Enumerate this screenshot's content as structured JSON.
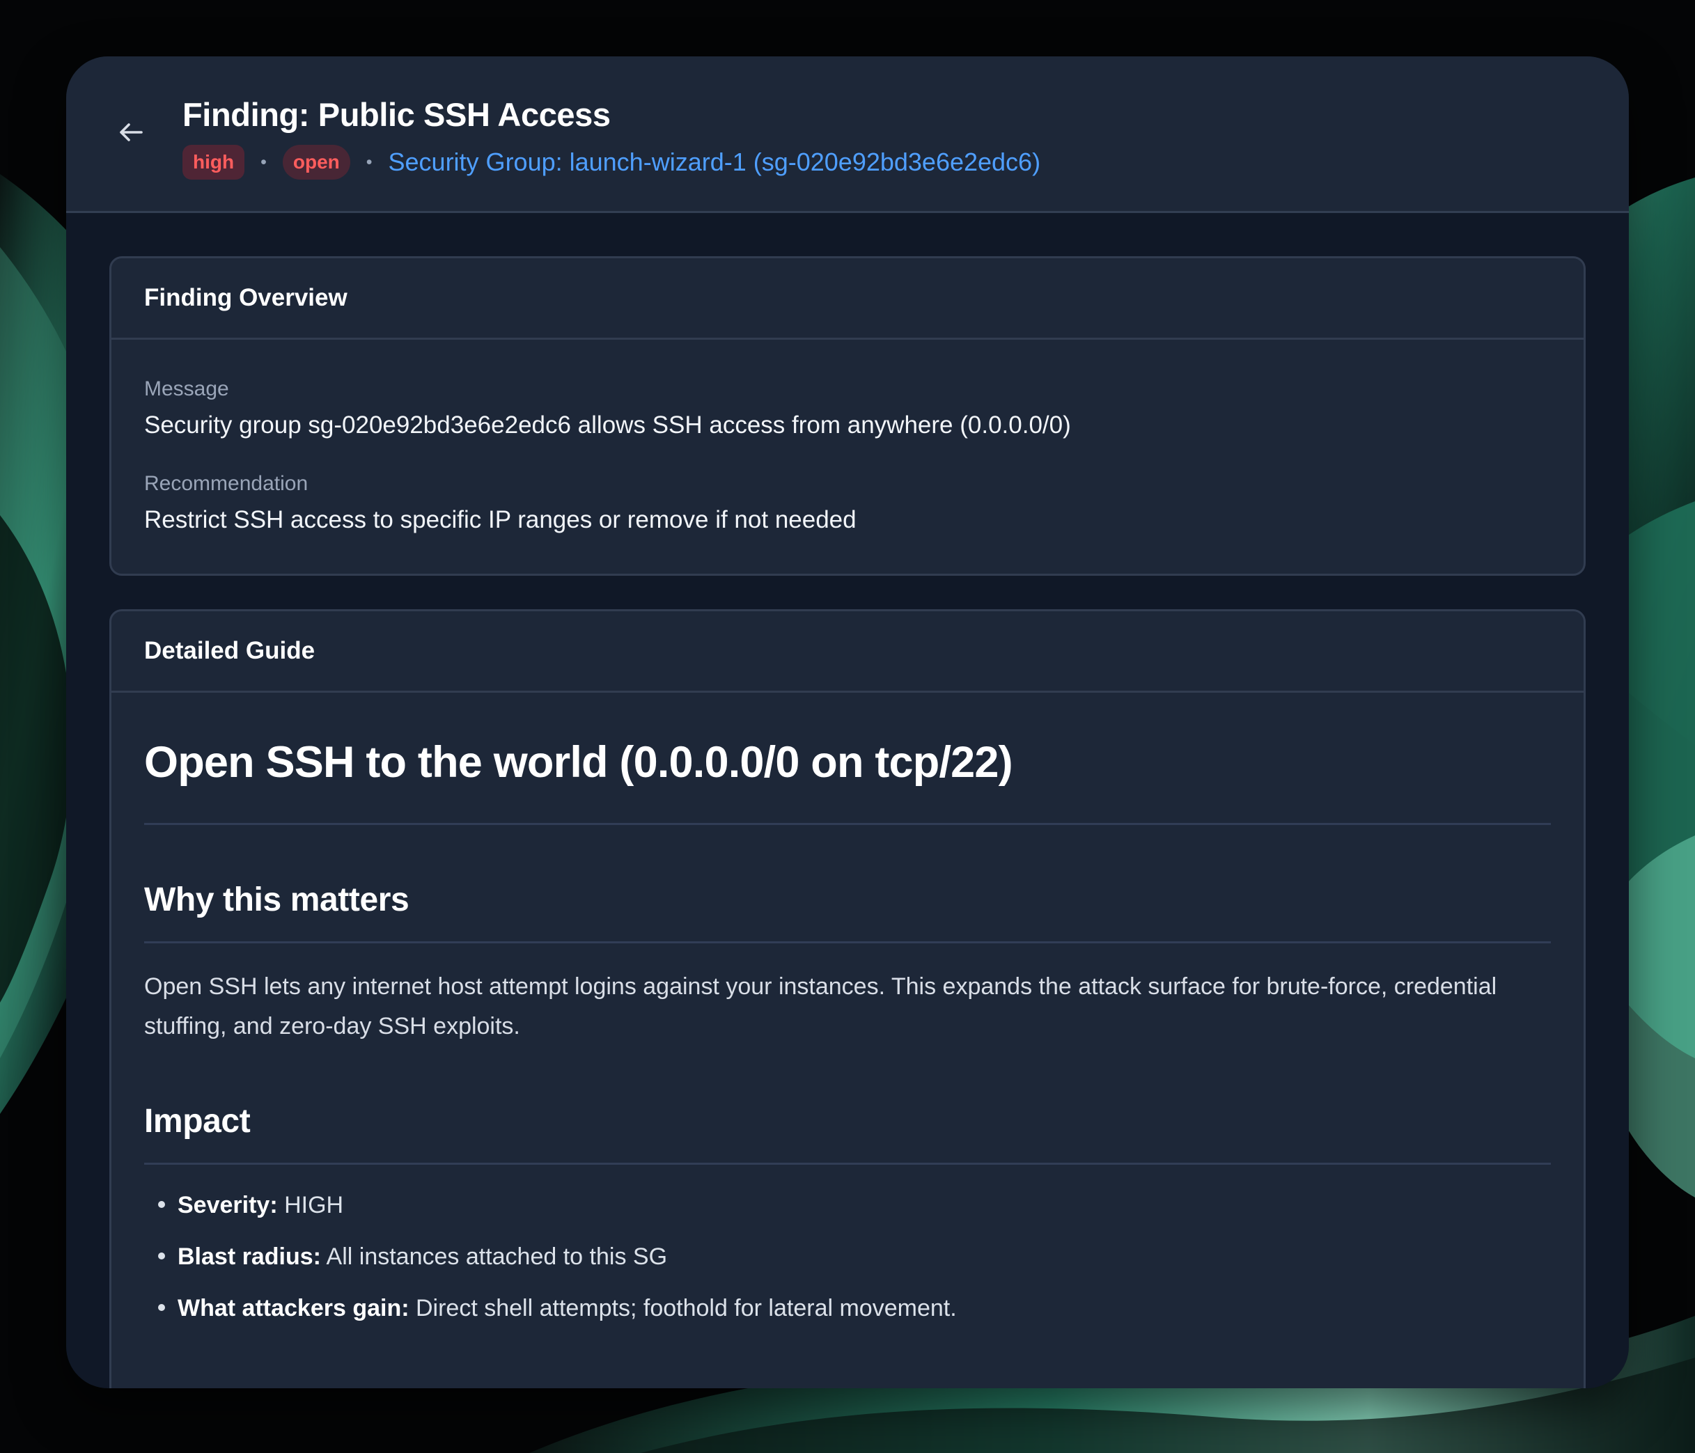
{
  "header": {
    "back_icon": "arrow-left-icon",
    "title": "Finding: Public SSH Access",
    "severity": "high",
    "status": "open",
    "resource": "Security Group: launch-wizard-1 (sg-020e92bd3e6e2edc6)",
    "separator": "•"
  },
  "overview": {
    "heading": "Finding Overview",
    "message_label": "Message",
    "message": "Security group sg-020e92bd3e6e2edc6 allows SSH access from anywhere (0.0.0.0/0)",
    "recommendation_label": "Recommendation",
    "recommendation": "Restrict SSH access to specific IP ranges or remove if not needed"
  },
  "guide": {
    "heading": "Detailed Guide",
    "title": "Open SSH to the world (0.0.0.0/0 on tcp/22)",
    "why": {
      "heading": "Why this matters",
      "text": "Open SSH lets any internet host attempt logins against your instances. This expands the attack surface for brute-force, credential stuffing, and zero-day SSH exploits."
    },
    "impact": {
      "heading": "Impact",
      "items": [
        {
          "term": "Severity:",
          "value": "HIGH"
        },
        {
          "term": "Blast radius:",
          "value": "All instances attached to this SG"
        },
        {
          "term": "What attackers gain:",
          "value": "Direct shell attempts; foothold for lateral movement."
        }
      ]
    }
  },
  "colors": {
    "page_background": "#101827",
    "panel_background": "#1d2738",
    "accent_link": "#4f9fff",
    "severity_red": "#ff5d5d",
    "wallpaper_green": "#3faa87"
  }
}
